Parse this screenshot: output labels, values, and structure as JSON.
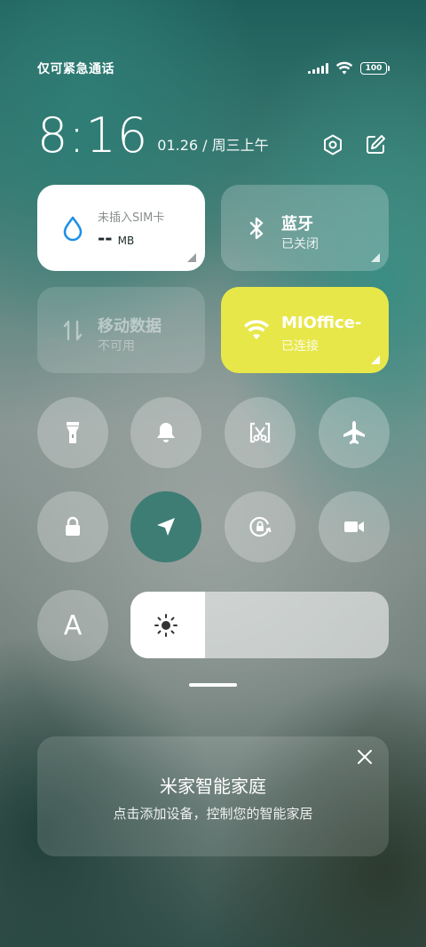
{
  "status": {
    "carrier": "仅可紧急通话",
    "battery": "100"
  },
  "clock": {
    "time": "8:16",
    "date": "01.26 / 周三上午"
  },
  "tiles": {
    "sim": {
      "title": "未插入SIM卡",
      "value": "--",
      "unit": "MB"
    },
    "bluetooth": {
      "title": "蓝牙",
      "sub": "已关闭"
    },
    "mobile_data": {
      "title": "移动数据",
      "sub": "不可用"
    },
    "wifi": {
      "title": "MIOffice-",
      "sub": "已连接"
    }
  },
  "toggles": [
    {
      "name": "flashlight-icon",
      "active": false
    },
    {
      "name": "bell-icon",
      "active": false
    },
    {
      "name": "screenshot-icon",
      "active": false
    },
    {
      "name": "airplane-icon",
      "active": false
    },
    {
      "name": "lock-icon",
      "active": false
    },
    {
      "name": "location-icon",
      "active": true
    },
    {
      "name": "rotation-lock-icon",
      "active": false
    },
    {
      "name": "video-camera-icon",
      "active": false
    }
  ],
  "brightness": {
    "auto_label": "A",
    "level": 0.29
  },
  "card": {
    "title": "米家智能家庭",
    "subtitle": "点击添加设备，控制您的智能家居"
  },
  "colors": {
    "wifi_active": "#e8e74a",
    "location_active": "#3d7d74"
  }
}
